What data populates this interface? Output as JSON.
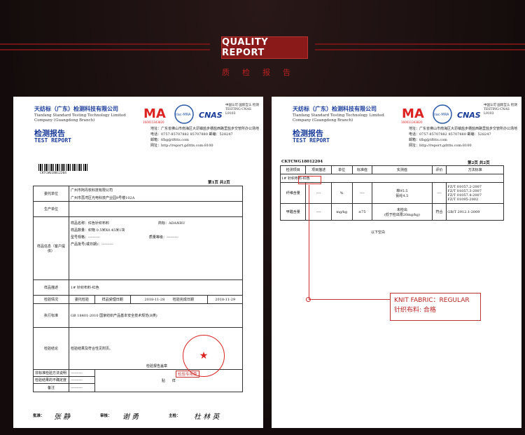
{
  "banner": {
    "title": "QUALITY REPORT",
    "subtitle": "质检报告"
  },
  "report_common": {
    "company_cn": "天纺标（广东）检测科技有限公司",
    "company_en": "Tianfang Standard Testing Technology Limited Company (Guangdong Branch)",
    "title_cn": "检测报告",
    "title_en": "TEST REPORT",
    "logo_ma": "MA",
    "logo_ma_no": "160011343820",
    "logo_ilac": "ilac-MRA",
    "logo_cnas": "CNAS",
    "cnas_no": "TESTING CNAS L9103",
    "reg_text": "中国认可 国际互认 检测",
    "address": "地址：广东省佛山市南海区大沥镇盐步穗盐西路里盐步交管所办公场地",
    "phone": "电话：0757-85707882 85707880  邮编：528247",
    "email": "邮箱：tfbg@tfttts.com",
    "web": "网址：http://report.gdttts.com:8100"
  },
  "left_doc": {
    "barcode_text": "CKTCWG18012204",
    "page": "第1页  共2页",
    "rows": {
      "client_label": "委托单位",
      "client_value1": "广州市阿丹软科技有限公司",
      "client_value2": "广州市荔湾区光电科技产业园9号楼102A",
      "maker_label": "生产单位",
      "maker_value": "",
      "sample_label": "样品信息（客户提供）",
      "sample_name_label": "样品名称：",
      "sample_name": "红色针织布料",
      "brand_label": "商标：",
      "brand": "ADANRU",
      "qty_label": "样品数量：",
      "qty": "织物 0.5米X0.45米1块",
      "model_label": "型号规格：",
      "model": "----------",
      "grade_label": "质量等级：",
      "grade": "----------",
      "batch_label": "产品批号(或日期)：",
      "batch": "----------",
      "desc_label": "样品描述",
      "desc_value": "1# 针织布料-红色",
      "test_label": "检验情况",
      "commission_label": "委托检验",
      "accept_label": "样品受理日期",
      "accept_date": "2018-11-28",
      "finish_label": "检验完成日期",
      "finish_date": "2018-11-29",
      "standard_label": "执行标准",
      "standard_value": "GB 18401-2010  国家纺织产品基本安全技术规范(B类)",
      "conclusion_label": "检验结论",
      "conclusion_value": "检验结果及符合性见附页。",
      "stamp_label": "检验专用章",
      "report_stamp": "检验报告盖章",
      "nonstd_label": "非标准检验方法说明",
      "nonstd_value": "----------",
      "deviation_label": "检验结果的不确定度",
      "deviation_value": "----------",
      "remark_label": "备注",
      "remark_value": "----------",
      "sample_photo_label": "贴　　样"
    },
    "signers": {
      "approve": "批准：",
      "approve_name": "张 静",
      "review": "审核：",
      "review_name": "谢 勇",
      "test": "主检：",
      "test_name": "杜 林 英"
    }
  },
  "right_doc": {
    "report_no": "CKTCWG18012204",
    "page": "第2页  共2页",
    "headers": [
      "检测项目",
      "项目描述",
      "单位",
      "标准值",
      "实测值",
      "评价",
      "方法标准"
    ],
    "sample_row": "1#  针织布料-红色",
    "rows": [
      {
        "item": "纤维含量",
        "desc": "----",
        "unit": "%",
        "std": "----",
        "result1": "棉95.5",
        "result2": "氨纶4.5",
        "eval": "----",
        "methods": [
          "FZ/T 01057.2-2007",
          "FZ/T 01057.3-2007",
          "FZ/T 01057.4-2007",
          "FZ/T 01095-2002"
        ]
      },
      {
        "item": "甲醛含量",
        "desc": "----",
        "unit": "mg/kg",
        "std": "≤75",
        "result1": "未检出",
        "result2": "(低于检出限20mg/kg)",
        "eval": "符合",
        "methods": [
          "GB/T 2912.1-2009"
        ]
      }
    ],
    "end_text": "以下空白"
  },
  "callout": {
    "line1": "KNIT FABRIC：REGULAR",
    "line2": "针织布料: 合格"
  },
  "colors": {
    "accent": "#8a1a1a",
    "doc_blue": "#1a3d9a",
    "stamp_red": "#dd2222"
  }
}
